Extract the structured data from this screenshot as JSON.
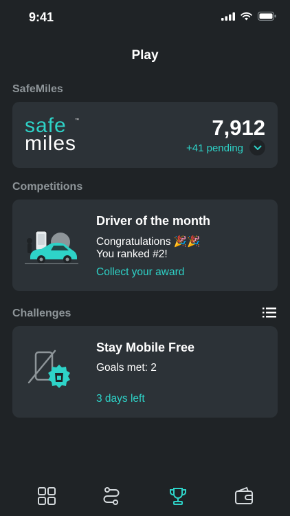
{
  "status": {
    "time": "9:41"
  },
  "page": {
    "title": "Play"
  },
  "safemiles": {
    "section_label": "SafeMiles",
    "logo_top": "safe",
    "logo_bottom": "miles",
    "logo_tm": "™",
    "miles": "7,912",
    "pending": "+41 pending"
  },
  "competitions": {
    "section_label": "Competitions",
    "title": "Driver of the month",
    "line1": "Congratulations 🎉🎉",
    "line2": "You ranked #2!",
    "link": "Collect your award"
  },
  "challenges": {
    "section_label": "Challenges",
    "title": "Stay Mobile Free",
    "goals": "Goals met: 2",
    "days_left": "3 days left"
  },
  "tabbar": {
    "items": [
      {
        "icon": "dashboard-grid-icon",
        "active": false
      },
      {
        "icon": "route-icon",
        "active": false
      },
      {
        "icon": "trophy-icon",
        "active": true
      },
      {
        "icon": "wallet-icon",
        "active": false
      }
    ]
  },
  "colors": {
    "background": "#1f2326",
    "card": "#2c3237",
    "accent": "#2ed3c8",
    "muted": "#8e9599"
  }
}
